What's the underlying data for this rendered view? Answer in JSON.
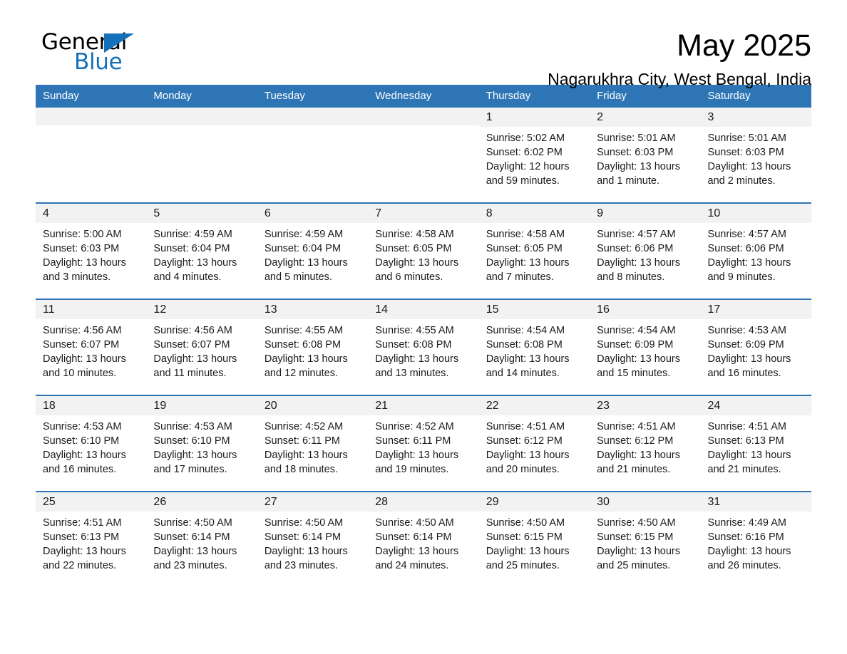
{
  "logo": {
    "word_one": "General",
    "word_two": "Blue",
    "triangle_icon": "triangle-icon"
  },
  "header": {
    "month_title": "May 2025",
    "location": "Nagarukhra City, West Bengal, India"
  },
  "colors": {
    "header_blue": "#2e75b6",
    "logo_blue": "#1470b8",
    "daynum_background": "#f2f2f2",
    "page_background": "#ffffff"
  },
  "calendar": {
    "weekday_headers": [
      "Sunday",
      "Monday",
      "Tuesday",
      "Wednesday",
      "Thursday",
      "Friday",
      "Saturday"
    ],
    "weeks": [
      [
        {
          "day": "",
          "empty": true
        },
        {
          "day": "",
          "empty": true
        },
        {
          "day": "",
          "empty": true
        },
        {
          "day": "",
          "empty": true
        },
        {
          "day": "1",
          "sunrise": "Sunrise: 5:02 AM",
          "sunset": "Sunset: 6:02 PM",
          "daylight": "Daylight: 12 hours and 59 minutes."
        },
        {
          "day": "2",
          "sunrise": "Sunrise: 5:01 AM",
          "sunset": "Sunset: 6:03 PM",
          "daylight": "Daylight: 13 hours and 1 minute."
        },
        {
          "day": "3",
          "sunrise": "Sunrise: 5:01 AM",
          "sunset": "Sunset: 6:03 PM",
          "daylight": "Daylight: 13 hours and 2 minutes."
        }
      ],
      [
        {
          "day": "4",
          "sunrise": "Sunrise: 5:00 AM",
          "sunset": "Sunset: 6:03 PM",
          "daylight": "Daylight: 13 hours and 3 minutes."
        },
        {
          "day": "5",
          "sunrise": "Sunrise: 4:59 AM",
          "sunset": "Sunset: 6:04 PM",
          "daylight": "Daylight: 13 hours and 4 minutes."
        },
        {
          "day": "6",
          "sunrise": "Sunrise: 4:59 AM",
          "sunset": "Sunset: 6:04 PM",
          "daylight": "Daylight: 13 hours and 5 minutes."
        },
        {
          "day": "7",
          "sunrise": "Sunrise: 4:58 AM",
          "sunset": "Sunset: 6:05 PM",
          "daylight": "Daylight: 13 hours and 6 minutes."
        },
        {
          "day": "8",
          "sunrise": "Sunrise: 4:58 AM",
          "sunset": "Sunset: 6:05 PM",
          "daylight": "Daylight: 13 hours and 7 minutes."
        },
        {
          "day": "9",
          "sunrise": "Sunrise: 4:57 AM",
          "sunset": "Sunset: 6:06 PM",
          "daylight": "Daylight: 13 hours and 8 minutes."
        },
        {
          "day": "10",
          "sunrise": "Sunrise: 4:57 AM",
          "sunset": "Sunset: 6:06 PM",
          "daylight": "Daylight: 13 hours and 9 minutes."
        }
      ],
      [
        {
          "day": "11",
          "sunrise": "Sunrise: 4:56 AM",
          "sunset": "Sunset: 6:07 PM",
          "daylight": "Daylight: 13 hours and 10 minutes."
        },
        {
          "day": "12",
          "sunrise": "Sunrise: 4:56 AM",
          "sunset": "Sunset: 6:07 PM",
          "daylight": "Daylight: 13 hours and 11 minutes."
        },
        {
          "day": "13",
          "sunrise": "Sunrise: 4:55 AM",
          "sunset": "Sunset: 6:08 PM",
          "daylight": "Daylight: 13 hours and 12 minutes."
        },
        {
          "day": "14",
          "sunrise": "Sunrise: 4:55 AM",
          "sunset": "Sunset: 6:08 PM",
          "daylight": "Daylight: 13 hours and 13 minutes."
        },
        {
          "day": "15",
          "sunrise": "Sunrise: 4:54 AM",
          "sunset": "Sunset: 6:08 PM",
          "daylight": "Daylight: 13 hours and 14 minutes."
        },
        {
          "day": "16",
          "sunrise": "Sunrise: 4:54 AM",
          "sunset": "Sunset: 6:09 PM",
          "daylight": "Daylight: 13 hours and 15 minutes."
        },
        {
          "day": "17",
          "sunrise": "Sunrise: 4:53 AM",
          "sunset": "Sunset: 6:09 PM",
          "daylight": "Daylight: 13 hours and 16 minutes."
        }
      ],
      [
        {
          "day": "18",
          "sunrise": "Sunrise: 4:53 AM",
          "sunset": "Sunset: 6:10 PM",
          "daylight": "Daylight: 13 hours and 16 minutes."
        },
        {
          "day": "19",
          "sunrise": "Sunrise: 4:53 AM",
          "sunset": "Sunset: 6:10 PM",
          "daylight": "Daylight: 13 hours and 17 minutes."
        },
        {
          "day": "20",
          "sunrise": "Sunrise: 4:52 AM",
          "sunset": "Sunset: 6:11 PM",
          "daylight": "Daylight: 13 hours and 18 minutes."
        },
        {
          "day": "21",
          "sunrise": "Sunrise: 4:52 AM",
          "sunset": "Sunset: 6:11 PM",
          "daylight": "Daylight: 13 hours and 19 minutes."
        },
        {
          "day": "22",
          "sunrise": "Sunrise: 4:51 AM",
          "sunset": "Sunset: 6:12 PM",
          "daylight": "Daylight: 13 hours and 20 minutes."
        },
        {
          "day": "23",
          "sunrise": "Sunrise: 4:51 AM",
          "sunset": "Sunset: 6:12 PM",
          "daylight": "Daylight: 13 hours and 21 minutes."
        },
        {
          "day": "24",
          "sunrise": "Sunrise: 4:51 AM",
          "sunset": "Sunset: 6:13 PM",
          "daylight": "Daylight: 13 hours and 21 minutes."
        }
      ],
      [
        {
          "day": "25",
          "sunrise": "Sunrise: 4:51 AM",
          "sunset": "Sunset: 6:13 PM",
          "daylight": "Daylight: 13 hours and 22 minutes."
        },
        {
          "day": "26",
          "sunrise": "Sunrise: 4:50 AM",
          "sunset": "Sunset: 6:14 PM",
          "daylight": "Daylight: 13 hours and 23 minutes."
        },
        {
          "day": "27",
          "sunrise": "Sunrise: 4:50 AM",
          "sunset": "Sunset: 6:14 PM",
          "daylight": "Daylight: 13 hours and 23 minutes."
        },
        {
          "day": "28",
          "sunrise": "Sunrise: 4:50 AM",
          "sunset": "Sunset: 6:14 PM",
          "daylight": "Daylight: 13 hours and 24 minutes."
        },
        {
          "day": "29",
          "sunrise": "Sunrise: 4:50 AM",
          "sunset": "Sunset: 6:15 PM",
          "daylight": "Daylight: 13 hours and 25 minutes."
        },
        {
          "day": "30",
          "sunrise": "Sunrise: 4:50 AM",
          "sunset": "Sunset: 6:15 PM",
          "daylight": "Daylight: 13 hours and 25 minutes."
        },
        {
          "day": "31",
          "sunrise": "Sunrise: 4:49 AM",
          "sunset": "Sunset: 6:16 PM",
          "daylight": "Daylight: 13 hours and 26 minutes."
        }
      ]
    ]
  }
}
